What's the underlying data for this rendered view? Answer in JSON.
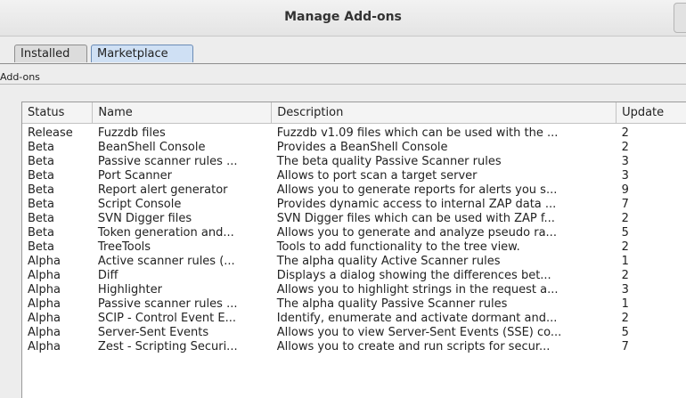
{
  "window": {
    "title": "Manage Add-ons"
  },
  "tabs": [
    {
      "label": "Installed"
    },
    {
      "label": "Marketplace",
      "selected": true
    }
  ],
  "section": {
    "label": "Add-ons"
  },
  "table": {
    "columns": [
      "Status",
      "Name",
      "Description",
      "Update"
    ],
    "rows": [
      [
        "Release",
        "Fuzzdb files",
        "Fuzzdb v1.09 files which can be used with the ...",
        "2"
      ],
      [
        "Beta",
        "BeanShell Console",
        "Provides a BeanShell Console",
        "2"
      ],
      [
        "Beta",
        "Passive scanner rules ...",
        "The beta quality Passive Scanner rules",
        "3"
      ],
      [
        "Beta",
        "Port Scanner",
        "Allows to port scan a target server",
        "3"
      ],
      [
        "Beta",
        "Report alert generator",
        "Allows you to generate reports for alerts you s...",
        "9"
      ],
      [
        "Beta",
        "Script Console",
        "Provides dynamic access to internal ZAP data ...",
        "7"
      ],
      [
        "Beta",
        "SVN Digger files",
        "SVN Digger files which can be used with ZAP f...",
        "2"
      ],
      [
        "Beta",
        "Token generation and...",
        "Allows you to generate and analyze pseudo ra...",
        "5"
      ],
      [
        "Beta",
        "TreeTools",
        "Tools to add functionality to the tree view.",
        "2"
      ],
      [
        "Alpha",
        "Active scanner rules (...",
        "The alpha quality Active Scanner rules",
        "1"
      ],
      [
        "Alpha",
        "Diff",
        "Displays a dialog showing the differences bet...",
        "2"
      ],
      [
        "Alpha",
        "Highlighter",
        "Allows you to highlight strings in the request a...",
        "3"
      ],
      [
        "Alpha",
        "Passive scanner rules ...",
        "The alpha quality Passive Scanner rules",
        "1"
      ],
      [
        "Alpha",
        "SCIP - Control Event E...",
        "Identify, enumerate and activate dormant and...",
        "2"
      ],
      [
        "Alpha",
        "Server-Sent Events",
        "Allows you to view Server-Sent Events (SSE) co...",
        "5"
      ],
      [
        "Alpha",
        "Zest - Scripting Securi...",
        "Allows you to create and run scripts for secur...",
        "7"
      ]
    ]
  }
}
